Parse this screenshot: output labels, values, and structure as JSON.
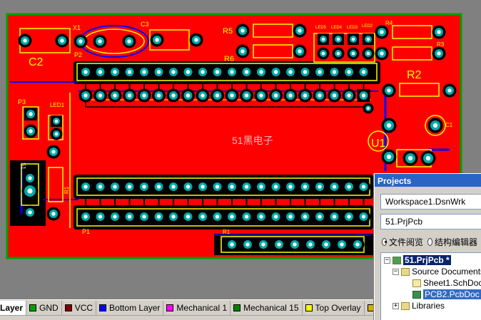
{
  "board": {
    "watermark": "51黑电子",
    "designators": [
      "C2",
      "X1",
      "C3",
      "P2",
      "R5",
      "R6",
      "LED5",
      "LED4",
      "LED3",
      "LED2",
      "R4",
      "R3",
      "R2",
      "P3",
      "LED1",
      "S1",
      "R1",
      "P1",
      "U1",
      "C1",
      "R1"
    ]
  },
  "colors": {
    "board": "#ff0000",
    "copper": "#000000",
    "overlay": "#ffff00",
    "pad": "#00aaaa",
    "bottom": "#0000ff",
    "outline": "#00a000"
  },
  "layer_tabs": [
    {
      "label": "Layer",
      "color": ""
    },
    {
      "label": "GND",
      "color": "#00a000"
    },
    {
      "label": "VCC",
      "color": "#800000"
    },
    {
      "label": "Bottom Layer",
      "color": "#0000ff"
    },
    {
      "label": "Mechanical 1",
      "color": "#ff00ff"
    },
    {
      "label": "Mechanical 15",
      "color": "#008000"
    },
    {
      "label": "Top Overlay",
      "color": "#ffff00"
    },
    {
      "label": "B",
      "color": "#d0b000"
    }
  ],
  "projects": {
    "title": "Projects",
    "workspace": "Workspace1.DsnWrk",
    "project": "51.PrjPcb",
    "radio_file_view": "文件阅览",
    "radio_struct_edit": "结构编辑器",
    "tree": {
      "project": "51.PrjPcb *",
      "source_documents": "Source Documents",
      "sheet": "Sheet1.SchDoc",
      "pcb": "PCB2.PcbDoc",
      "libraries": "Libraries"
    }
  }
}
